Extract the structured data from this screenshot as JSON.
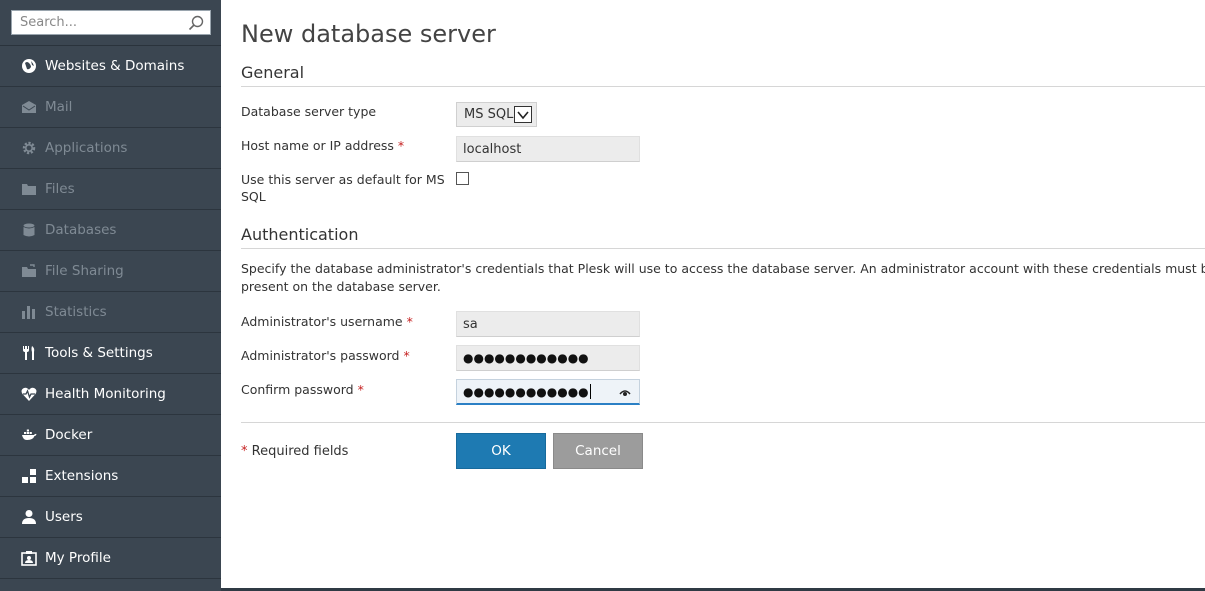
{
  "sidebar": {
    "search_placeholder": "Search...",
    "items": [
      {
        "label": "Websites & Domains",
        "icon": "globe-icon",
        "enabled": true
      },
      {
        "label": "Mail",
        "icon": "mail-icon",
        "enabled": false
      },
      {
        "label": "Applications",
        "icon": "gear-icon",
        "enabled": false
      },
      {
        "label": "Files",
        "icon": "folder-icon",
        "enabled": false
      },
      {
        "label": "Databases",
        "icon": "database-icon",
        "enabled": false
      },
      {
        "label": "File Sharing",
        "icon": "file-sharing-icon",
        "enabled": false
      },
      {
        "label": "Statistics",
        "icon": "bar-chart-icon",
        "enabled": false
      },
      {
        "label": "Tools & Settings",
        "icon": "tools-icon",
        "enabled": true
      },
      {
        "label": "Health Monitoring",
        "icon": "heart-pulse-icon",
        "enabled": true
      },
      {
        "label": "Docker",
        "icon": "docker-icon",
        "enabled": true
      },
      {
        "label": "Extensions",
        "icon": "extensions-icon",
        "enabled": true
      },
      {
        "label": "Users",
        "icon": "user-icon",
        "enabled": true
      },
      {
        "label": "My Profile",
        "icon": "profile-icon",
        "enabled": true
      }
    ]
  },
  "page": {
    "title": "New database server"
  },
  "general": {
    "title": "General",
    "server_type_label": "Database server type",
    "server_type_value": "MS SQL",
    "host_label": "Host name or IP address",
    "host_value": "localhost",
    "default_label": "Use this server as default for MS SQL",
    "default_checked": false
  },
  "auth": {
    "title": "Authentication",
    "description": "Specify the database administrator's credentials that Plesk will use to access the database server. An administrator account with these credentials must be present on the database server.",
    "username_label": "Administrator's username",
    "username_value": "sa",
    "password_label": "Administrator's password",
    "password_value": "●●●●●●●●●●●●",
    "confirm_label": "Confirm password",
    "confirm_value": "●●●●●●●●●●●●"
  },
  "footer": {
    "required_marker": "*",
    "required_text": "Required fields",
    "ok_label": "OK",
    "cancel_label": "Cancel"
  },
  "required_marker": "*",
  "colors": {
    "sidebar_bg": "#3b4651",
    "accent": "#1e7ab2",
    "required": "#c51f1f"
  }
}
